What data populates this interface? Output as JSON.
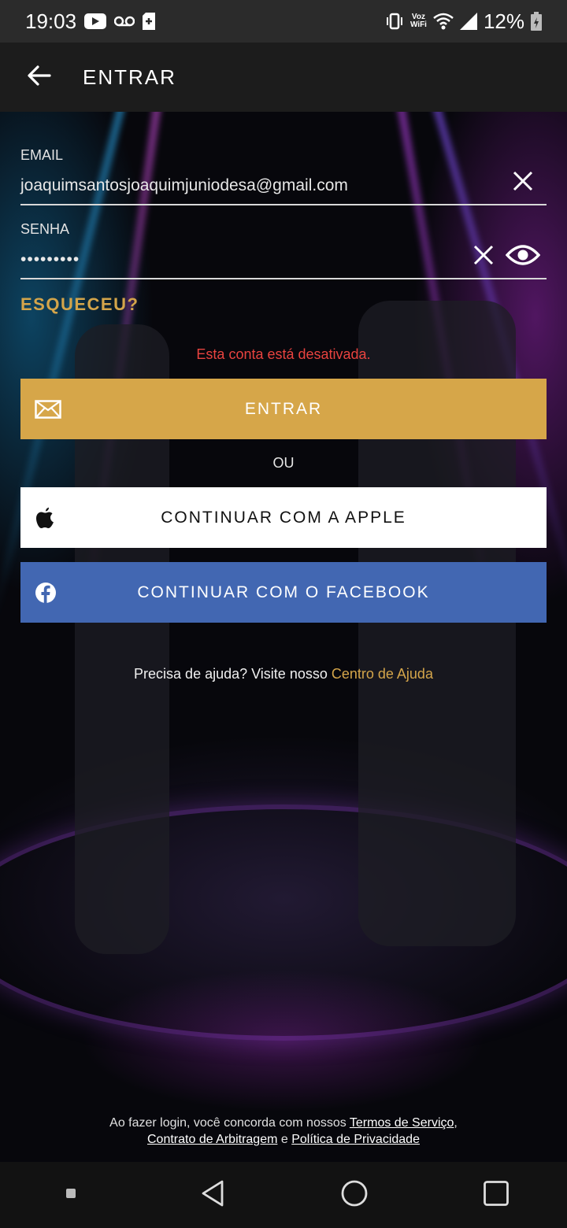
{
  "status_bar": {
    "time": "19:03",
    "voz_line1": "Voz",
    "voz_line2": "WiFi",
    "battery": "12%",
    "icons": [
      "youtube-icon",
      "voicemail-icon",
      "sd-card-icon",
      "vibrate-icon",
      "wifi-icon",
      "signal-icon",
      "battery-icon"
    ]
  },
  "app_bar": {
    "title": "ENTRAR",
    "back_icon": "arrow-left-icon"
  },
  "form": {
    "email_label": "EMAIL",
    "email_value": "joaquimsantosjoaquimjuniodesa@gmail.com",
    "password_label": "SENHA",
    "password_value": "•••••••••",
    "forgot": "ESQUECEU?",
    "error": "Esta conta está desativada."
  },
  "buttons": {
    "entrar": "ENTRAR",
    "or": "OU",
    "apple": "CONTINUAR COM A APPLE",
    "facebook": "CONTINUAR COM O FACEBOOK"
  },
  "help": {
    "text": "Precisa de ajuda? Visite nosso ",
    "link": "Centro de Ajuda"
  },
  "legal": {
    "prefix": "Ao fazer login, você concorda com nossos ",
    "terms": "Termos de Serviço",
    "comma": ",",
    "arbitration": "Contrato de Arbitragem",
    "and": " e ",
    "privacy": "Política de Privacidade"
  },
  "colors": {
    "accent_gold": "#d6a649",
    "facebook_blue": "#4267b2",
    "error_red": "#e8433f"
  }
}
